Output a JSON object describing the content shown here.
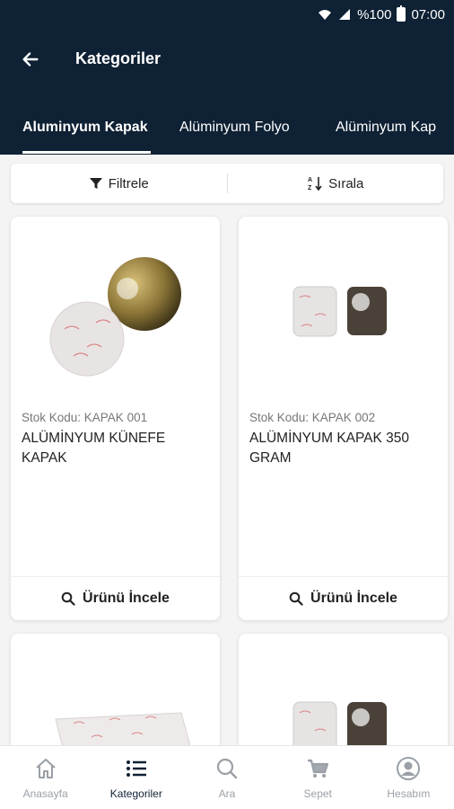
{
  "status_bar": {
    "battery_text": "%100",
    "time": "07:00"
  },
  "header": {
    "title": "Kategoriler"
  },
  "tabs": [
    {
      "label": "Aluminyum Kapak",
      "active": true
    },
    {
      "label": "Alüminyum Folyo",
      "active": false
    },
    {
      "label": "Alüminyum Kap",
      "active": false
    }
  ],
  "toolbar": {
    "filter_label": "Filtrele",
    "sort_label": "Sırala"
  },
  "products": [
    {
      "code": "Stok Kodu: KAPAK 001",
      "name": "ALÜMİNYUM KÜNEFE KAPAK",
      "action_label": "Ürünü İncele"
    },
    {
      "code": "Stok Kodu: KAPAK 002",
      "name": "ALÜMİNYUM KAPAK 350 GRAM",
      "action_label": "Ürünü İncele"
    }
  ],
  "bottom_nav": [
    {
      "label": "Anasayfa",
      "icon": "home-icon",
      "active": false
    },
    {
      "label": "Kategoriler",
      "icon": "list-icon",
      "active": true
    },
    {
      "label": "Ara",
      "icon": "search-icon",
      "active": false
    },
    {
      "label": "Sepet",
      "icon": "cart-icon",
      "active": false
    },
    {
      "label": "Hesabım",
      "icon": "account-icon",
      "active": false
    }
  ],
  "colors": {
    "header_bg": "#0f2134",
    "page_bg": "#f4f4f4",
    "nav_inactive": "#9aa0a6"
  }
}
